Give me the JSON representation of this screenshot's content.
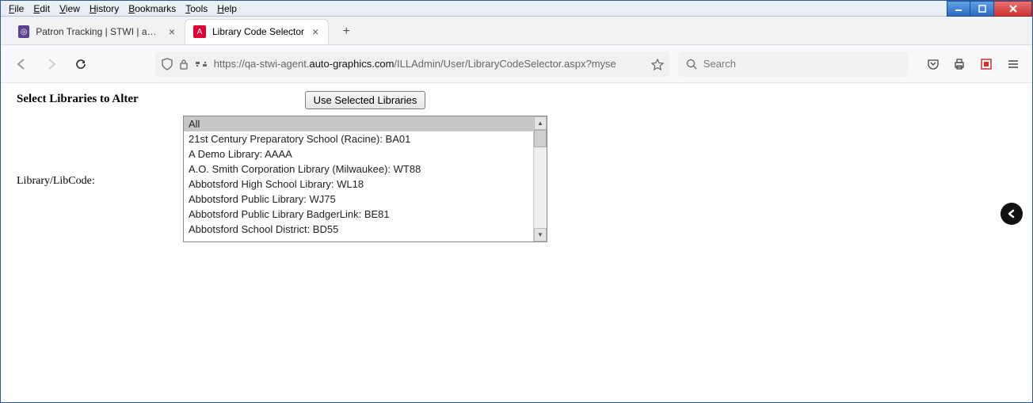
{
  "menubar": {
    "items": [
      {
        "label": "File",
        "u": "F"
      },
      {
        "label": "Edit",
        "u": "E"
      },
      {
        "label": "View",
        "u": "V"
      },
      {
        "label": "History",
        "u": "H"
      },
      {
        "label": "Bookmarks",
        "u": "B"
      },
      {
        "label": "Tools",
        "u": "T"
      },
      {
        "label": "Help",
        "u": "H"
      }
    ]
  },
  "tabs": [
    {
      "title": "Patron Tracking | STWI | aaaa | A",
      "active": false
    },
    {
      "title": "Library Code Selector",
      "active": true
    }
  ],
  "addressbar": {
    "url_faded_prefix": "https://qa-stwi-agent.",
    "url_dark": "auto-graphics.com",
    "url_faded_suffix": "/ILLAdmin/User/LibraryCodeSelector.aspx?myse"
  },
  "searchbar": {
    "placeholder": "Search"
  },
  "page": {
    "heading": "Select Libraries to Alter",
    "use_button": "Use Selected Libraries",
    "list_label": "Library/LibCode:",
    "options": [
      "All",
      "21st Century Preparatory School (Racine): BA01",
      "A Demo Library: AAAA",
      "A.O. Smith Corporation Library (Milwaukee): WT88",
      "Abbotsford High School Library: WL18",
      "Abbotsford Public Library: WJ75",
      "Abbotsford Public Library BadgerLink: BE81",
      "Abbotsford School District: BD55"
    ],
    "selected_index": 0
  }
}
